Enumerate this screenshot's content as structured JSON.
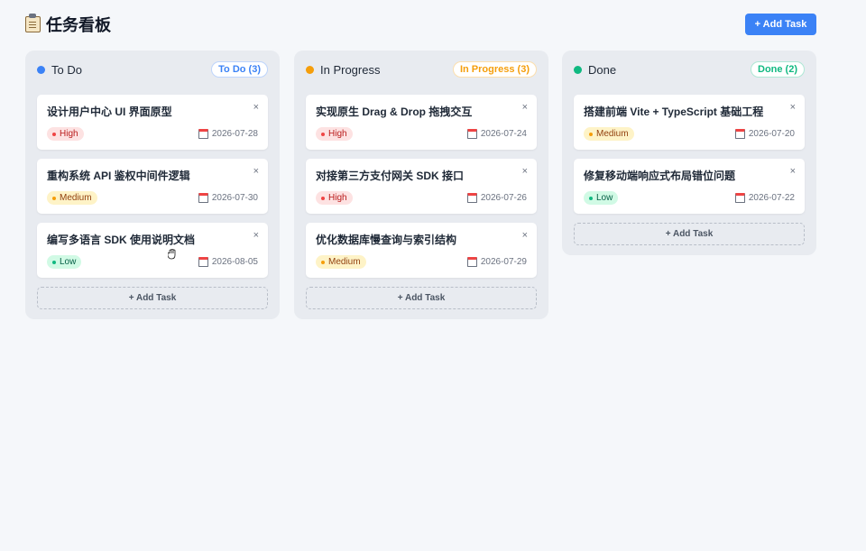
{
  "header": {
    "title": "任务看板",
    "add_button": "+ Add Task"
  },
  "columns": [
    {
      "name": "To Do",
      "badge": "To Do (3)",
      "color": "#3b82f6",
      "add_label": "+ Add Task",
      "cards": [
        {
          "title": "设计用户中心 UI 界面原型",
          "priority": "High",
          "level": "high",
          "due": "2026-07-28"
        },
        {
          "title": "重构系统 API 鉴权中间件逻辑",
          "priority": "Medium",
          "level": "medium",
          "due": "2026-07-30"
        },
        {
          "title": "编写多语言 SDK 使用说明文档",
          "priority": "Low",
          "level": "low",
          "due": "2026-08-05"
        }
      ]
    },
    {
      "name": "In Progress",
      "badge": "In Progress (3)",
      "color": "#f59e0b",
      "add_label": "+ Add Task",
      "cards": [
        {
          "title": "实现原生 Drag & Drop 拖拽交互",
          "priority": "High",
          "level": "high",
          "due": "2026-07-24"
        },
        {
          "title": "对接第三方支付网关 SDK 接口",
          "priority": "High",
          "level": "high",
          "due": "2026-07-26"
        },
        {
          "title": "优化数据库慢查询与索引结构",
          "priority": "Medium",
          "level": "medium",
          "due": "2026-07-29"
        }
      ]
    },
    {
      "name": "Done",
      "badge": "Done (2)",
      "color": "#10b981",
      "add_label": "+ Add Task",
      "cards": [
        {
          "title": "搭建前端 Vite + TypeScript 基础工程",
          "priority": "Medium",
          "level": "medium",
          "due": "2026-07-20"
        },
        {
          "title": "修复移动端响应式布局错位问题",
          "priority": "Low",
          "level": "low",
          "due": "2026-07-22"
        }
      ]
    }
  ],
  "close_glyph": "×",
  "icons": {
    "title": "clipboard-icon",
    "due": "calendar-icon",
    "close": "close-icon",
    "cursor": "grab-hand-icon"
  }
}
